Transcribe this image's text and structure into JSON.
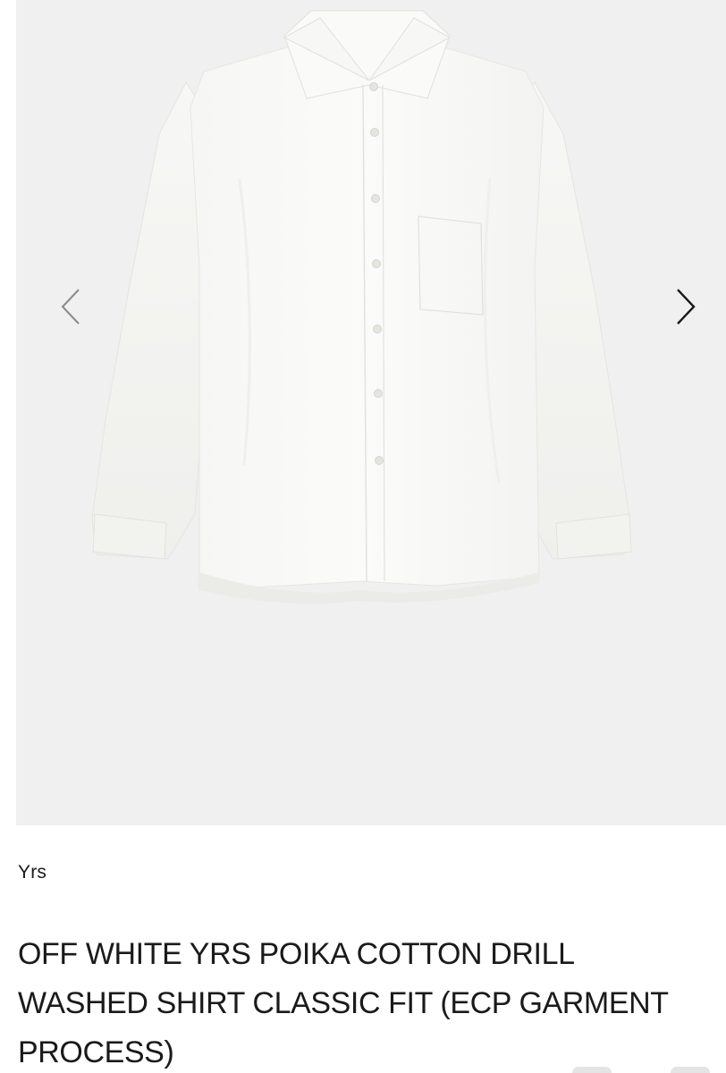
{
  "gallery": {
    "image_subject": "off-white long sleeve button-up shirt",
    "prev_icon": "chevron-left-icon",
    "next_icon": "chevron-right-icon",
    "background_color": "#f0f0f0"
  },
  "product": {
    "brand": "Yrs",
    "title": "OFF WHITE YRS POIKA COTTON DRILL WASHED SHIRT CLASSIC FIT (ECP GARMENT PROCESS)"
  }
}
